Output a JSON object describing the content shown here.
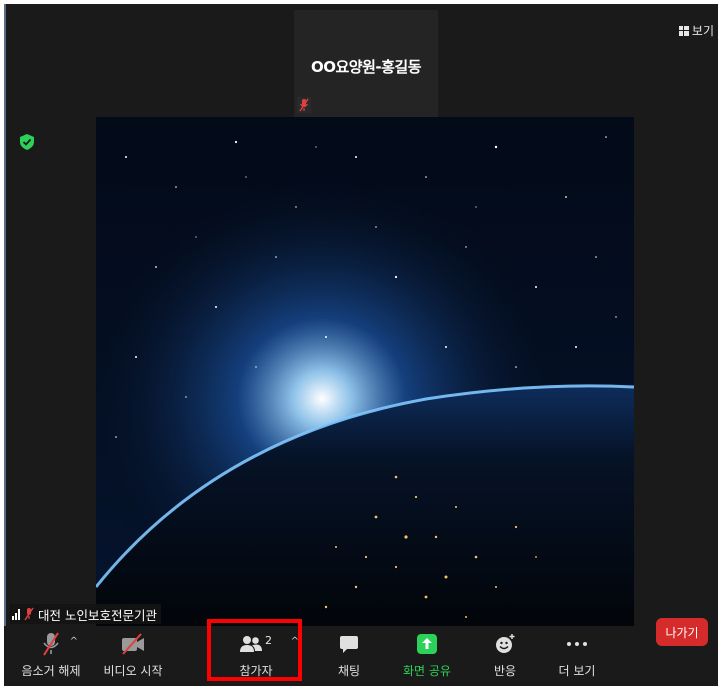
{
  "window": {
    "view_label": "보기"
  },
  "top_participant": {
    "name": "OO요양원-홍길동",
    "mic_state": "muted"
  },
  "self_view": {
    "name": "대전 노인보호전문기관",
    "mic_state": "muted"
  },
  "toolbar": {
    "unmute_label": "음소거 해제",
    "video_label": "비디오 시작",
    "participants_label": "참가자",
    "participants_count": "2",
    "chat_label": "채팅",
    "share_label": "화면 공유",
    "reactions_label": "반응",
    "more_label": "더 보기",
    "leave_label": "나가기"
  },
  "colors": {
    "background": "#1a1a1a",
    "share_accent": "#2bd158",
    "leave": "#d52b2b",
    "highlight": "#ff0000",
    "security": "#2bd158"
  },
  "icons": [
    "grid-view-icon",
    "security-shield-icon",
    "mic-muted-icon",
    "video-off-icon",
    "participants-icon",
    "chat-icon",
    "share-screen-icon",
    "reaction-icon",
    "more-icon",
    "signal-icon"
  ]
}
